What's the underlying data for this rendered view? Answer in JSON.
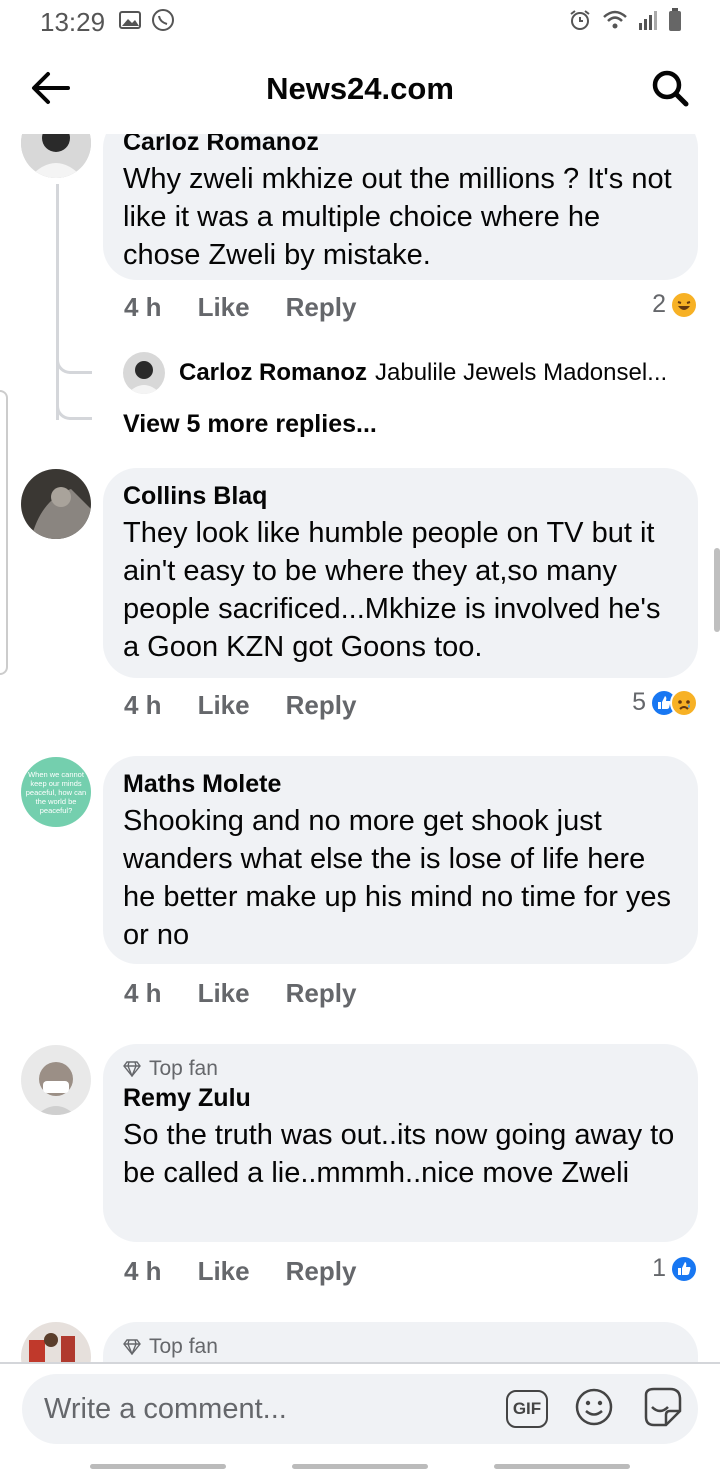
{
  "status_bar": {
    "time": "13:29"
  },
  "header": {
    "title": "News24.com"
  },
  "comments": [
    {
      "author": "Carloz Romanoz",
      "text": "Why zweli mkhize out the millions ? It's not like it was a multiple choice where he chose Zweli by mistake.",
      "time": "4 h",
      "like": "Like",
      "reply": "Reply",
      "reaction_count": "2",
      "reply_preview": {
        "name": "Carloz Romanoz",
        "text": "Jabulile Jewels Madonsel..."
      },
      "more_replies": "View 5 more replies..."
    },
    {
      "author": "Collins Blaq",
      "text": "They look like humble people on TV but it ain't easy to be where they at,so many people sacrificed...Mkhize is involved he's a Goon KZN got Goons too.",
      "time": "4 h",
      "like": "Like",
      "reply": "Reply",
      "reaction_count": "5"
    },
    {
      "author": "Maths Molete",
      "avatar_text": "When we cannot keep our minds peaceful, how can the world be peaceful?",
      "text": "Shooking and no more get shook just wanders what else the is lose of life here he better make up his mind no time for yes or no",
      "time": "4 h",
      "like": "Like",
      "reply": "Reply"
    },
    {
      "badge": "Top fan",
      "author": "Remy Zulu",
      "text": "So the truth was out..its now going away to be called a lie..mmmh..nice move Zweli",
      "time": "4 h",
      "like": "Like",
      "reply": "Reply",
      "reaction_count": "1"
    },
    {
      "badge": "Top fan"
    }
  ],
  "composer": {
    "placeholder": "Write a comment...",
    "gif_label": "GIF"
  },
  "colors": {
    "like_blue": "#1877f2",
    "bubble_bg": "#f0f2f5",
    "secondary_text": "#65676b",
    "avatar_teal": "#74cfae"
  },
  "icons": [
    "back-arrow-icon",
    "search-icon",
    "haha-reaction-icon",
    "like-reaction-icon",
    "sad-reaction-icon",
    "diamond-icon",
    "emoji-icon",
    "sticker-icon"
  ]
}
